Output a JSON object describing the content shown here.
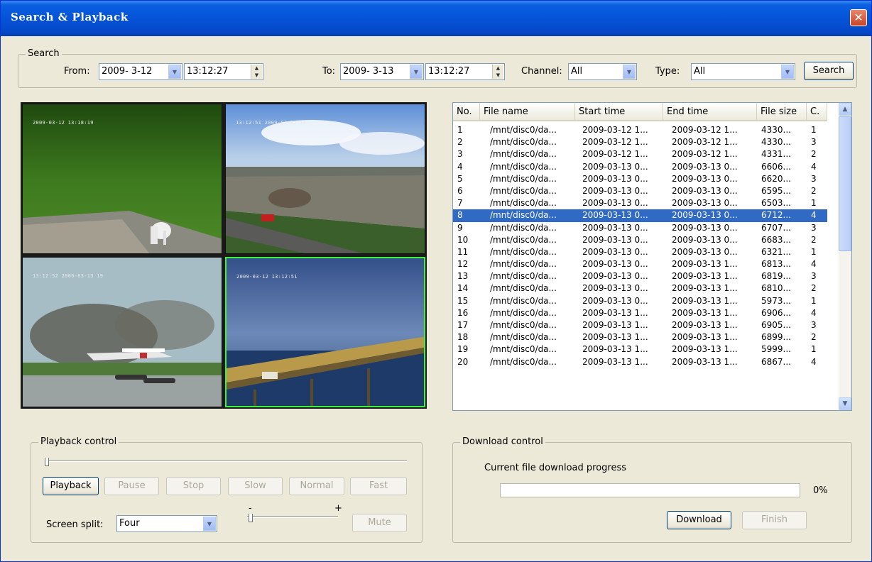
{
  "window": {
    "title": "Search & Playback",
    "close_glyph": "✕"
  },
  "search": {
    "legend": "Search",
    "from_label": "From:",
    "from_date": "2009- 3-12",
    "from_time": "13:12:27",
    "to_label": "To:",
    "to_date": "2009- 3-13",
    "to_time": "13:12:27",
    "channel_label": "Channel:",
    "channel_value": "All",
    "type_label": "Type:",
    "type_value": "All",
    "search_button": "Search"
  },
  "video": {
    "tiles": [
      {
        "osd": "2009-03-12 13:18:19",
        "scene": "dog-on-grass"
      },
      {
        "osd": "13:12:51 2009-03-12 19",
        "scene": "river-highway"
      },
      {
        "osd": "13:12:52 2009-03-13 19",
        "scene": "seaplane-takeoff"
      },
      {
        "osd": "2009-03-12 13:12:51",
        "scene": "bridge-traffic"
      }
    ],
    "active_tile": 4
  },
  "file_list": {
    "columns": [
      "No.",
      "File name",
      "Start time",
      "End time",
      "File size",
      "C."
    ],
    "rows": [
      [
        "1",
        "/mnt/disc0/da...",
        "2009-03-12 1...",
        "2009-03-12 1...",
        "4330...",
        "1"
      ],
      [
        "2",
        "/mnt/disc0/da...",
        "2009-03-12 1...",
        "2009-03-12 1...",
        "4330...",
        "3"
      ],
      [
        "3",
        "/mnt/disc0/da...",
        "2009-03-12 1...",
        "2009-03-12 1...",
        "4331...",
        "2"
      ],
      [
        "4",
        "/mnt/disc0/da...",
        "2009-03-13 0...",
        "2009-03-13 0...",
        "6606...",
        "4"
      ],
      [
        "5",
        "/mnt/disc0/da...",
        "2009-03-13 0...",
        "2009-03-13 0...",
        "6620...",
        "3"
      ],
      [
        "6",
        "/mnt/disc0/da...",
        "2009-03-13 0...",
        "2009-03-13 0...",
        "6595...",
        "2"
      ],
      [
        "7",
        "/mnt/disc0/da...",
        "2009-03-13 0...",
        "2009-03-13 0...",
        "6503...",
        "1"
      ],
      [
        "8",
        "/mnt/disc0/da...",
        "2009-03-13 0...",
        "2009-03-13 0...",
        "6712...",
        "4"
      ],
      [
        "9",
        "/mnt/disc0/da...",
        "2009-03-13 0...",
        "2009-03-13 0...",
        "6707...",
        "3"
      ],
      [
        "10",
        "/mnt/disc0/da...",
        "2009-03-13 0...",
        "2009-03-13 0...",
        "6683...",
        "2"
      ],
      [
        "11",
        "/mnt/disc0/da...",
        "2009-03-13 0...",
        "2009-03-13 0...",
        "6321...",
        "1"
      ],
      [
        "12",
        "/mnt/disc0/da...",
        "2009-03-13 0...",
        "2009-03-13 1...",
        "6813...",
        "4"
      ],
      [
        "13",
        "/mnt/disc0/da...",
        "2009-03-13 0...",
        "2009-03-13 1...",
        "6819...",
        "3"
      ],
      [
        "14",
        "/mnt/disc0/da...",
        "2009-03-13 0...",
        "2009-03-13 1...",
        "6810...",
        "2"
      ],
      [
        "15",
        "/mnt/disc0/da...",
        "2009-03-13 0...",
        "2009-03-13 1...",
        "5973...",
        "1"
      ],
      [
        "16",
        "/mnt/disc0/da...",
        "2009-03-13 1...",
        "2009-03-13 1...",
        "6906...",
        "4"
      ],
      [
        "17",
        "/mnt/disc0/da...",
        "2009-03-13 1...",
        "2009-03-13 1...",
        "6905...",
        "3"
      ],
      [
        "18",
        "/mnt/disc0/da...",
        "2009-03-13 1...",
        "2009-03-13 1...",
        "6899...",
        "2"
      ],
      [
        "19",
        "/mnt/disc0/da...",
        "2009-03-13 1...",
        "2009-03-13 1...",
        "5999...",
        "1"
      ],
      [
        "20",
        "/mnt/disc0/da...",
        "2009-03-13 1...",
        "2009-03-13 1...",
        "6867...",
        "4"
      ]
    ],
    "selected_row": 8,
    "scroll_up_icon": "chevron-up-icon",
    "scroll_down_icon": "chevron-down-icon"
  },
  "playback": {
    "legend": "Playback control",
    "position_fraction": 0,
    "buttons": {
      "playback": "Playback",
      "pause": "Pause",
      "stop": "Stop",
      "slow": "Slow",
      "normal": "Normal",
      "fast": "Fast"
    },
    "screen_split_label": "Screen split:",
    "screen_split_value": "Four",
    "volume_minus": "-",
    "volume_plus": "+",
    "volume_fraction": 0,
    "mute": "Mute"
  },
  "download": {
    "legend": "Download control",
    "progress_label": "Current file download progress",
    "progress_percent": "0%",
    "progress_value": 0,
    "download_button": "Download",
    "finish_button": "Finish"
  },
  "colors": {
    "titlebar": "#0553d8",
    "selection": "#316ac5",
    "active_tile_border": "#3ff03f",
    "dialog_bg": "#ece9d8"
  }
}
